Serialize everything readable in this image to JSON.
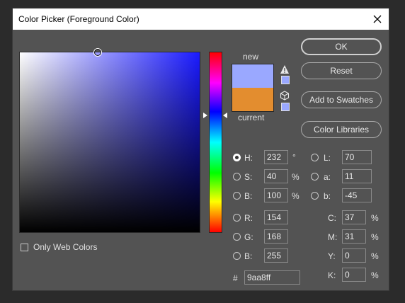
{
  "window": {
    "title": "Color Picker (Foreground Color)"
  },
  "preview": {
    "new_label": "new",
    "current_label": "current",
    "new_color": "#9aa8ff",
    "current_color": "#e38d2f"
  },
  "buttons": {
    "ok": "OK",
    "reset": "Reset",
    "add_swatches": "Add to Swatches",
    "color_libraries": "Color Libraries"
  },
  "hsb": {
    "h_label": "H:",
    "h": "232",
    "h_unit": "°",
    "s_label": "S:",
    "s": "40",
    "s_unit": "%",
    "b_label": "B:",
    "b": "100",
    "b_unit": "%"
  },
  "lab": {
    "l_label": "L:",
    "l": "70",
    "a_label": "a:",
    "a": "11",
    "b_label": "b:",
    "b": "-45"
  },
  "rgb": {
    "r_label": "R:",
    "r": "154",
    "g_label": "G:",
    "g": "168",
    "b_label": "B:",
    "b": "255"
  },
  "cmyk": {
    "c_label": "C:",
    "c": "37",
    "m_label": "M:",
    "m": "31",
    "y_label": "Y:",
    "y": "0",
    "k_label": "K:",
    "k": "0",
    "unit": "%"
  },
  "hex": {
    "label": "#",
    "value": "9aa8ff"
  },
  "web_colors": {
    "label": "Only Web Colors",
    "checked": false
  },
  "icons": {
    "close": "close-icon",
    "warning": "warning-icon",
    "cube": "cube-icon"
  }
}
